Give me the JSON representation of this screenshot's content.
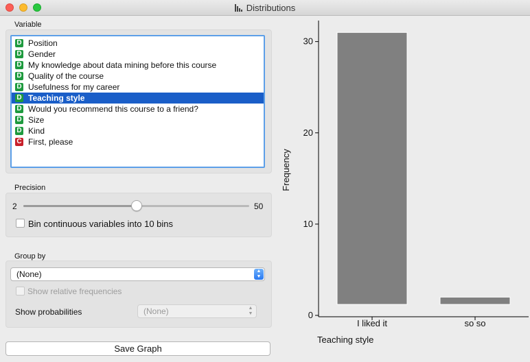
{
  "window": {
    "title": "Distributions"
  },
  "variable": {
    "label": "Variable",
    "items": [
      {
        "type": "D",
        "name": "Position"
      },
      {
        "type": "D",
        "name": "Gender"
      },
      {
        "type": "D",
        "name": "My knowledge about data mining before this course"
      },
      {
        "type": "D",
        "name": "Quality of the course"
      },
      {
        "type": "D",
        "name": "Usefulness for my career"
      },
      {
        "type": "D",
        "name": "Teaching style",
        "selected": true
      },
      {
        "type": "D",
        "name": "Would you recommend this course to a friend?"
      },
      {
        "type": "D",
        "name": "Size"
      },
      {
        "type": "D",
        "name": "Kind"
      },
      {
        "type": "C",
        "name": "First, please"
      }
    ]
  },
  "precision": {
    "label": "Precision",
    "min_label": "2",
    "max_label": "50",
    "slider_value_fraction": 0.5,
    "bin_label": "Bin continuous variables into 10 bins",
    "bin_checked": false
  },
  "group_by": {
    "label": "Group by",
    "selected": "(None)",
    "relative_label": "Show relative frequencies",
    "relative_checked": false,
    "prob_label": "Show probabilities",
    "prob_selected": "(None)"
  },
  "save_button": "Save Graph",
  "colors": {
    "bar": "#808080",
    "selection": "#1a5ec8",
    "discrete_badge": "#1e9a3e",
    "continuous_badge": "#c8202a"
  },
  "chart_data": {
    "type": "bar",
    "categories": [
      "I liked it",
      "so so"
    ],
    "values": [
      31,
      2
    ],
    "xlabel": "Teaching style",
    "ylabel": "Frequency",
    "ylim": [
      0,
      32
    ],
    "yticks": [
      "0",
      "10",
      "20",
      "30"
    ],
    "grid": false
  }
}
